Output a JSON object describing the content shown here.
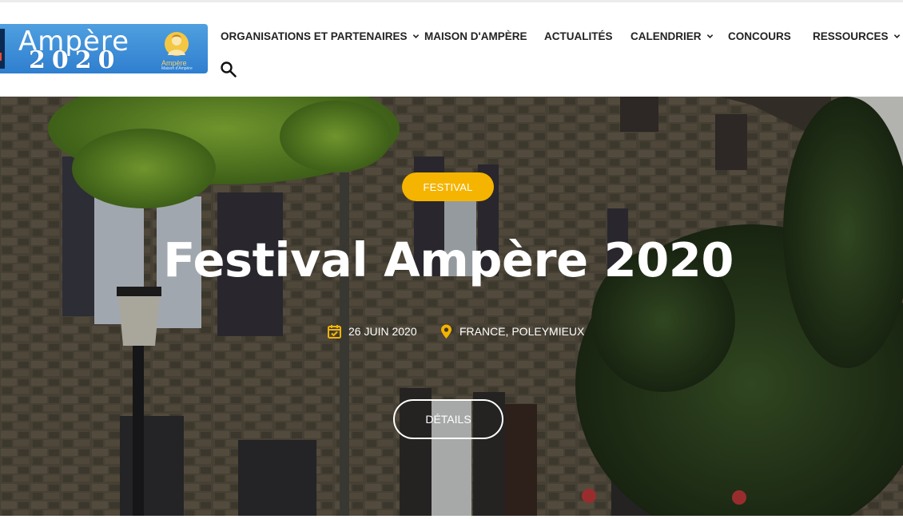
{
  "logo": {
    "title": "Ampère",
    "year": "2020",
    "caption": "Ampère",
    "subcaption": "Maison d'Ampère"
  },
  "nav": {
    "items": [
      {
        "label": "ORGANISATIONS ET PARTENAIRES",
        "dropdown": true
      },
      {
        "label": "MAISON D'AMPÈRE",
        "dropdown": false
      },
      {
        "label": "ACTUALITÉS",
        "dropdown": false
      },
      {
        "label": "CALENDRIER",
        "dropdown": true
      },
      {
        "label": "CONCOURS",
        "dropdown": false
      },
      {
        "label": "RESSOURCES",
        "dropdown": true
      }
    ],
    "search_icon": "search-icon"
  },
  "hero": {
    "badge": "FESTIVAL",
    "title": "Festival Ampère 2020",
    "date": "26 JUIN 2020",
    "location": "FRANCE, POLEYMIEUX",
    "button": "DÉTAILS",
    "icons": {
      "date": "calendar-check-icon",
      "location": "map-pin-icon"
    }
  },
  "colors": {
    "accent": "#f5b400",
    "logo_blue": "#3a8ad8",
    "nav_text": "#222222",
    "hero_text": "#ffffff"
  }
}
